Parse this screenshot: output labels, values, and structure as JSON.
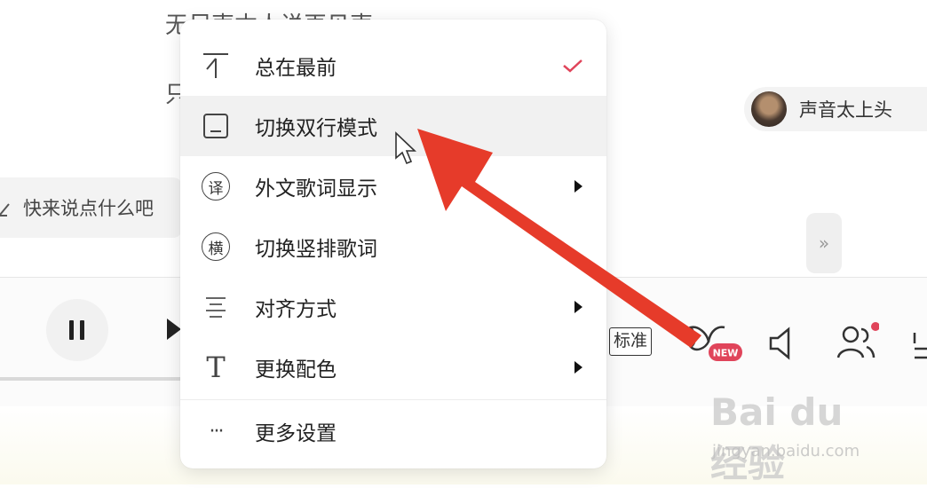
{
  "background": {
    "lyric_line_1": "无尽声本人说再见声",
    "lyric_line_2": "只",
    "comment_placeholder": "快来说点什么吧",
    "artist_name": "声音太上头",
    "expand_label": "»",
    "quality_label": "标准",
    "effect_badge": "NEW"
  },
  "context_menu": {
    "items": [
      {
        "label": "总在最前",
        "icon": "pin-top-icon",
        "checked": true
      },
      {
        "label": "切换双行模式",
        "icon": "double-line-icon",
        "hovered": true
      },
      {
        "label": "外文歌词显示",
        "icon": "translate-icon",
        "icon_char": "译",
        "submenu": true
      },
      {
        "label": "切换竖排歌词",
        "icon": "vertical-lyric-icon",
        "icon_char": "横"
      },
      {
        "label": "对齐方式",
        "icon": "align-icon",
        "submenu": true
      },
      {
        "label": "更换配色",
        "icon": "text-color-icon",
        "icon_char": "T",
        "submenu": true
      },
      {
        "label": "更多设置",
        "icon": "more-icon",
        "icon_char": "···"
      }
    ]
  },
  "watermark": {
    "main": "Bai du 经验",
    "sub": "jingyan.baidu.com"
  },
  "colors": {
    "accent": "#e0445a",
    "arrow": "#e63b2a",
    "menu_hover": "#f1f1f1"
  }
}
